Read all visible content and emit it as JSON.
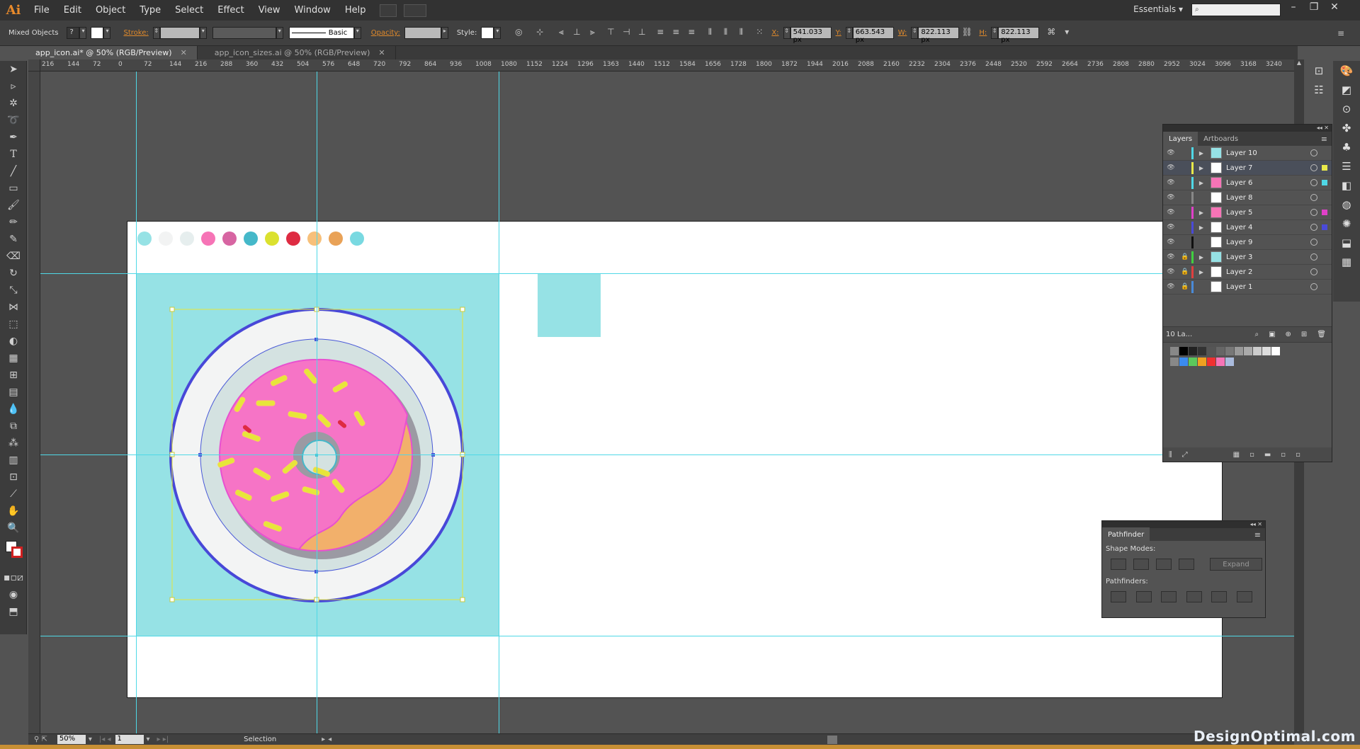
{
  "app": {
    "logo": "Ai",
    "workspace": "Essentials ▾"
  },
  "menu": [
    "File",
    "Edit",
    "Object",
    "Type",
    "Select",
    "Effect",
    "View",
    "Window",
    "Help"
  ],
  "controlbar": {
    "selection_label": "Mixed Objects",
    "stroke_label": "Stroke:",
    "style_brush": "Basic",
    "opacity_label": "Opacity:",
    "style_label": "Style:",
    "x_label": "X:",
    "x_value": "541.033 px",
    "y_label": "Y:",
    "y_value": "663.543 px",
    "w_label": "W:",
    "w_value": "822.113 px",
    "h_label": "H:",
    "h_value": "822.113 px"
  },
  "tabs": [
    {
      "label": "app_icon.ai* @ 50% (RGB/Preview)",
      "active": true
    },
    {
      "label": "app_icon_sizes.ai @ 50% (RGB/Preview)",
      "active": false
    }
  ],
  "ruler_ticks": [
    "216",
    "144",
    "72",
    "0",
    "72",
    "144",
    "216",
    "288",
    "360",
    "432",
    "504",
    "576",
    "648",
    "720",
    "792",
    "864",
    "936",
    "1008",
    "1080",
    "1152",
    "1224",
    "1296",
    "1363",
    "1440",
    "1512",
    "1584",
    "1656",
    "1728",
    "1800",
    "1872",
    "1944",
    "2016",
    "2088",
    "2160",
    "2232",
    "2304",
    "2376",
    "2448",
    "2520",
    "2592",
    "2664",
    "2736",
    "2808",
    "2880",
    "2952",
    "3024",
    "3096",
    "3168",
    "3240"
  ],
  "swatches": [
    "#96e2e5",
    "#f2f3f3",
    "#e6eeee",
    "#f674b6",
    "#d765a2",
    "#45b8c9",
    "#dbe12f",
    "#de2b42",
    "#f7c07a",
    "#e9a257",
    "#79d9e1"
  ],
  "layers": {
    "tab_layers": "Layers",
    "tab_artboards": "Artboards",
    "count_label": "10 La...",
    "rows": [
      {
        "name": "Layer 10",
        "color": "#4fd8e6",
        "thumb": "#96e2e5",
        "expand": true,
        "locked": false,
        "selected": false,
        "sel_color": ""
      },
      {
        "name": "Layer 7",
        "color": "#e8e84a",
        "thumb": "#ffffff",
        "expand": true,
        "locked": false,
        "selected": true,
        "sel_color": "#e8e84a"
      },
      {
        "name": "Layer 6",
        "color": "#4fd8e6",
        "thumb": "#f674b6",
        "expand": true,
        "locked": false,
        "selected": false,
        "sel_color": "#4fd8e6"
      },
      {
        "name": "Layer 8",
        "color": "#888888",
        "thumb": "#ffffff",
        "expand": false,
        "locked": false,
        "selected": false,
        "sel_color": ""
      },
      {
        "name": "Layer 5",
        "color": "#e040c8",
        "thumb": "#f674b6",
        "expand": true,
        "locked": false,
        "selected": false,
        "sel_color": "#e040c8"
      },
      {
        "name": "Layer 4",
        "color": "#4a4ad8",
        "thumb": "#ffffff",
        "expand": true,
        "locked": false,
        "selected": false,
        "sel_color": "#4a4ad8"
      },
      {
        "name": "Layer 9",
        "color": "#111111",
        "thumb": "#ffffff",
        "expand": false,
        "locked": false,
        "selected": false,
        "sel_color": ""
      },
      {
        "name": "Layer 3",
        "color": "#40d040",
        "thumb": "#96e2e5",
        "expand": true,
        "locked": true,
        "selected": false,
        "sel_color": ""
      },
      {
        "name": "Layer 2",
        "color": "#e04040",
        "thumb": "#ffffff",
        "expand": true,
        "locked": true,
        "selected": false,
        "sel_color": ""
      },
      {
        "name": "Layer 1",
        "color": "#4a8ad8",
        "thumb": "#ffffff",
        "expand": false,
        "locked": true,
        "selected": false,
        "sel_color": ""
      }
    ]
  },
  "pathfinder": {
    "title": "Pathfinder",
    "shape_modes": "Shape Modes:",
    "pathfinders": "Pathfinders:",
    "expand": "Expand"
  },
  "statusbar": {
    "zoom": "50%",
    "artboard": "1",
    "tool": "Selection"
  },
  "watermark": "DesignOptimal.com"
}
